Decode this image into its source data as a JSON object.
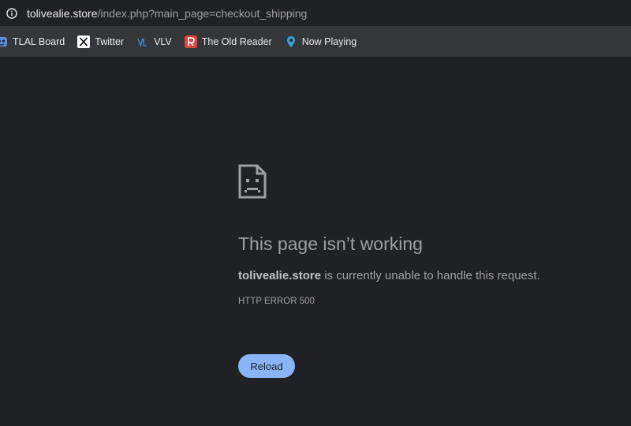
{
  "address_bar": {
    "host": "tolivealie.store",
    "path": "/index.php?main_page=checkout_shipping",
    "info_icon": "info-circle-icon"
  },
  "bookmarks": [
    {
      "label": "TLAL Board",
      "icon": "mask-icon"
    },
    {
      "label": "Twitter",
      "icon": "x-logo-icon"
    },
    {
      "label": "VLV",
      "icon": "vlv-logo-icon"
    },
    {
      "label": "The Old Reader",
      "icon": "old-reader-icon"
    },
    {
      "label": "Now Playing",
      "icon": "location-pin-icon"
    }
  ],
  "error": {
    "icon": "sad-page-icon",
    "title": "This page isn’t working",
    "host": "tolivealie.store",
    "message": " is currently unable to handle this request.",
    "code": "HTTP ERROR 500",
    "reload_label": "Reload"
  },
  "colors": {
    "page_bg": "#202124",
    "bookmarks_bg": "#35363a",
    "text_secondary": "#9aa0a6",
    "button_bg": "#8ab4f8"
  }
}
